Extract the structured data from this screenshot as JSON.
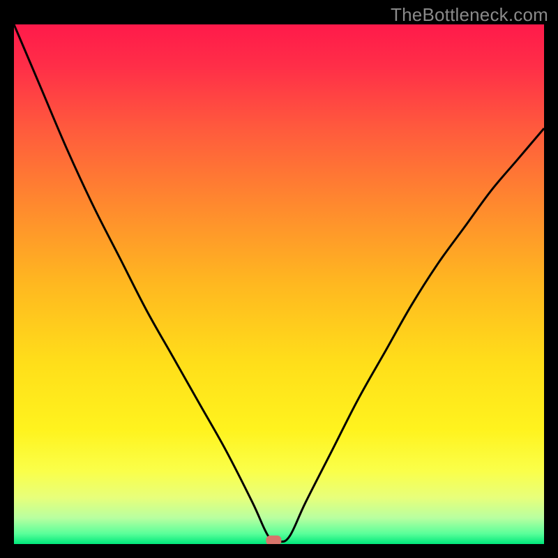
{
  "watermark": "TheBottleneck.com",
  "chart_data": {
    "type": "line",
    "title": "",
    "xlabel": "",
    "ylabel": "",
    "xlim": [
      0,
      100
    ],
    "ylim": [
      0,
      100
    ],
    "grid": false,
    "background": "rainbow-gradient-red-to-green",
    "series": [
      {
        "name": "bottleneck-curve",
        "x": [
          0,
          5,
          10,
          15,
          20,
          25,
          30,
          35,
          40,
          45,
          48,
          50,
          52,
          55,
          60,
          65,
          70,
          75,
          80,
          85,
          90,
          95,
          100
        ],
        "y": [
          100,
          88,
          76,
          65,
          55,
          45,
          36,
          27,
          18,
          8,
          1.5,
          0.5,
          1.5,
          8,
          18,
          28,
          37,
          46,
          54,
          61,
          68,
          74,
          80
        ]
      }
    ],
    "marker": {
      "name": "optimum-point",
      "x": 49,
      "y": 0.7,
      "color": "#d8756b"
    },
    "line_color": "#000000",
    "line_width": 3
  }
}
